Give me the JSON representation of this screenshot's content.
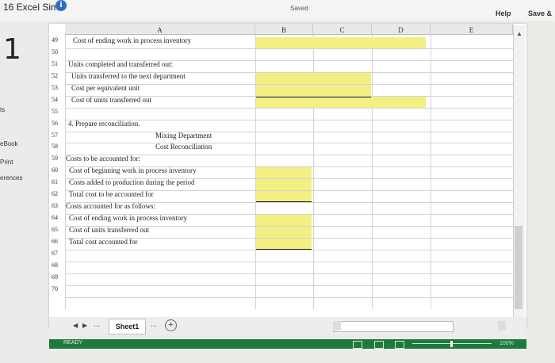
{
  "app": {
    "title": "16 Excel Sims",
    "saved": "Saved",
    "help": "Help",
    "save": "Save &"
  },
  "left_panel": {
    "question_number": "1",
    "items": [
      "ts",
      "eBook",
      "Print",
      "erences"
    ]
  },
  "columns": [
    "A",
    "B",
    "C",
    "D",
    "E"
  ],
  "rows": [
    {
      "num": "49",
      "text": "Cost of ending work in process inventory"
    },
    {
      "num": "50",
      "text": ""
    },
    {
      "num": "51",
      "text": "Units completed and transferred out:"
    },
    {
      "num": "52",
      "text": "Units transferred to the next department"
    },
    {
      "num": "53",
      "text": "Cost per equivalent unit"
    },
    {
      "num": "54",
      "text": "Cost of units transferred out"
    },
    {
      "num": "55",
      "text": ""
    },
    {
      "num": "56",
      "text": "4. Prepare reconciliation."
    },
    {
      "num": "57",
      "text": "Mixing Department"
    },
    {
      "num": "58",
      "text": "Cost Reconciliation"
    },
    {
      "num": "59",
      "text": "Costs to be accounted for:"
    },
    {
      "num": "60",
      "text": "Cost of beginning work in process inventory"
    },
    {
      "num": "61",
      "text": "Costs added to production during the period"
    },
    {
      "num": "62",
      "text": "Total cost to be accounted for"
    },
    {
      "num": "63",
      "text": "Costs accounted for as follows:"
    },
    {
      "num": "64",
      "text": "Cost of ending work in process inventory"
    },
    {
      "num": "65",
      "text": "Cost of units transferred out"
    },
    {
      "num": "66",
      "text": "Total cost accounted for"
    },
    {
      "num": "67",
      "text": ""
    },
    {
      "num": "68",
      "text": ""
    },
    {
      "num": "69",
      "text": ""
    },
    {
      "num": "70",
      "text": ""
    }
  ],
  "tabs": {
    "ellipsis_left": "...",
    "sheet": "Sheet1",
    "ellipsis_right": "...",
    "add": "+"
  },
  "status": {
    "ready": "READY",
    "zoom": "100%"
  },
  "colors": {
    "highlight": "#f3ef82",
    "status_bar": "#1e7a3c"
  }
}
